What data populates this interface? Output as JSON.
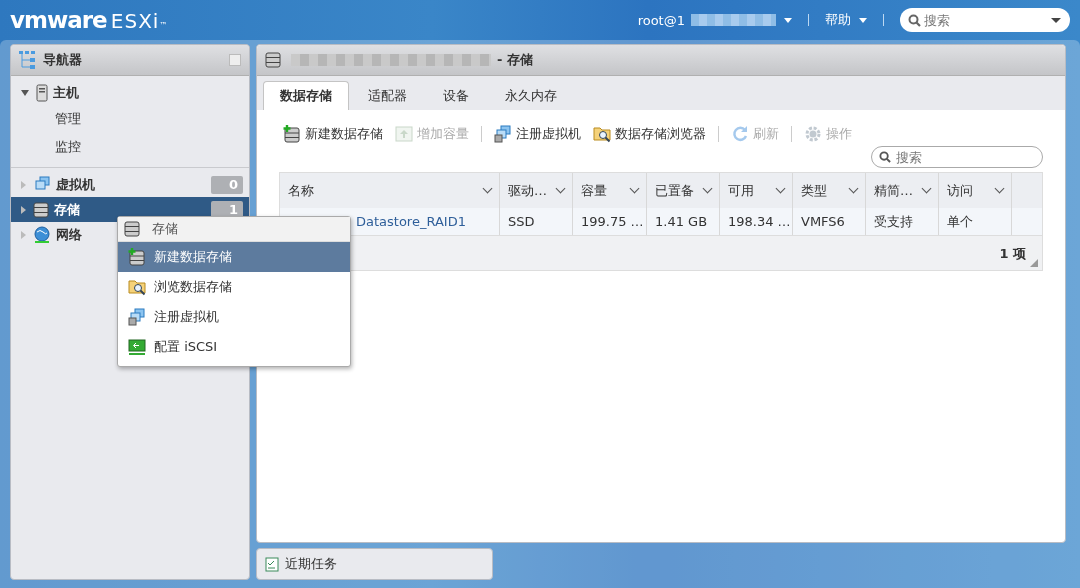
{
  "header": {
    "brand": "vmware",
    "product": "ESXi",
    "mark": "™",
    "user": "root@1",
    "help": "帮助",
    "search": {
      "placeholder": "搜索"
    }
  },
  "navigator": {
    "title": "导航器",
    "items": [
      {
        "kind": "host",
        "label": "主机",
        "expanded": true,
        "selected": false,
        "children": [
          {
            "label": "管理"
          },
          {
            "label": "监控"
          }
        ]
      },
      {
        "kind": "vm",
        "label": "虚拟机",
        "count": "0",
        "expanded": false,
        "selected": false
      },
      {
        "kind": "storage",
        "label": "存储",
        "count": "1",
        "expanded": false,
        "selected": true
      },
      {
        "kind": "network",
        "label": "网络",
        "expanded": false,
        "selected": false
      }
    ]
  },
  "panel": {
    "title": "- 存储",
    "tabs": [
      {
        "label": "数据存储",
        "selected": true
      },
      {
        "label": "适配器",
        "selected": false
      },
      {
        "label": "设备",
        "selected": false
      },
      {
        "label": "永久内存",
        "selected": false
      }
    ],
    "toolbar": [
      {
        "kind": "new",
        "label": "新建数据存储",
        "disabled": false
      },
      {
        "kind": "grow",
        "label": "增加容量",
        "disabled": true
      },
      {
        "kind": "register",
        "label": "注册虚拟机",
        "disabled": false
      },
      {
        "kind": "browse",
        "label": "数据存储浏览器",
        "disabled": false
      },
      {
        "kind": "refresh",
        "label": "刷新",
        "disabled": true
      },
      {
        "kind": "actions",
        "label": "操作",
        "disabled": true
      }
    ],
    "search": {
      "placeholder": "搜索"
    },
    "table": {
      "columns": [
        "名称",
        "驱动…",
        "容量",
        "已置备",
        "可用",
        "类型",
        "精简…",
        "访问"
      ],
      "rows": [
        [
          "Datastore_RAID1",
          "SSD",
          "199.75 …",
          "1.41 GB",
          "198.34 …",
          "VMFS6",
          "受支持",
          "单个"
        ]
      ],
      "footer": "1 项"
    }
  },
  "context_menu": {
    "title": "存储",
    "items": [
      {
        "kind": "new",
        "label": "新建数据存储",
        "selected": true
      },
      {
        "kind": "browse",
        "label": "浏览数据存储",
        "selected": false
      },
      {
        "kind": "register",
        "label": "注册虚拟机",
        "selected": false
      },
      {
        "kind": "iscsi",
        "label": "配置 iSCSI",
        "selected": false
      }
    ]
  },
  "recent_tasks": {
    "title": "近期任务"
  }
}
